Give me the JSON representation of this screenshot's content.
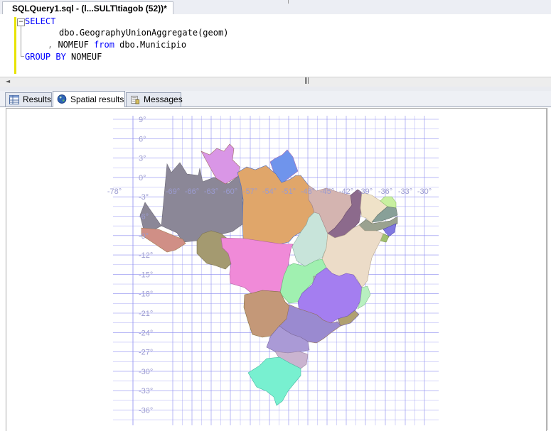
{
  "window": {
    "tab_title": "SQLQuery1.sql - (l...SULT\\tiagob (52))*"
  },
  "editor": {
    "line1": {
      "keyword": "SELECT"
    },
    "line2": {
      "text": "dbo.GeographyUnionAggregate(geom)"
    },
    "line3": {
      "comma": ",",
      "col": " NOMEUF ",
      "from_kw": "from",
      "table": " dbo.Municipio"
    },
    "line4": {
      "group_kw": "GROUP BY",
      "col": " NOMEUF"
    },
    "fold_symbol": "−"
  },
  "result_tabs": [
    {
      "label": "Results",
      "icon": "grid-icon"
    },
    {
      "label": "Spatial results",
      "icon": "globe-icon",
      "active": true
    },
    {
      "label": "Messages",
      "icon": "messages-icon"
    }
  ],
  "spatial": {
    "lon_labels": [
      "-78°",
      "-69°",
      "-66°",
      "-63°",
      "-60°",
      "-57°",
      "-54°",
      "-51°",
      "-48°",
      "-45°",
      "-42°",
      "-39°",
      "-36°",
      "-33°",
      "-30°"
    ],
    "lat_labels": [
      "9°",
      "6°",
      "3°",
      "0°",
      "-3°",
      "-6°",
      "-9°",
      "-12°",
      "-15°",
      "-18°",
      "-21°",
      "-24°",
      "-27°",
      "-30°",
      "-33°",
      "-36°"
    ],
    "grid_color": "#8c8cf0",
    "label_color": "#9b9bd0",
    "states": [
      {
        "name": "Amazonas",
        "color": "#8b8797"
      },
      {
        "name": "Roraima",
        "color": "#d08f86"
      },
      {
        "name": "Amapá",
        "color": "#d996e6"
      },
      {
        "name": "Pará",
        "color": "#6f94ec"
      },
      {
        "name": "Acre",
        "color": "#e0a66a"
      },
      {
        "name": "Rondônia",
        "color": "#a49a70"
      },
      {
        "name": "Mato Grosso",
        "color": "#f08ad8"
      },
      {
        "name": "Tocantins",
        "color": "#c8e4da"
      },
      {
        "name": "Maranhão",
        "color": "#d4b4b0"
      },
      {
        "name": "Piauí",
        "color": "#8c6a8c"
      },
      {
        "name": "Ceará",
        "color": "#efe2c8"
      },
      {
        "name": "Rio Grande do Norte",
        "color": "#c8f0a0"
      },
      {
        "name": "Paraíba",
        "color": "#88a098"
      },
      {
        "name": "Pernambuco",
        "color": "#9aa290"
      },
      {
        "name": "Alagoas",
        "color": "#8078e0"
      },
      {
        "name": "Sergipe",
        "color": "#a0c070"
      },
      {
        "name": "Bahia",
        "color": "#ecdcc8"
      },
      {
        "name": "Goiás",
        "color": "#a0f0b0"
      },
      {
        "name": "Distrito Federal",
        "color": "#b0b0b0"
      },
      {
        "name": "Minas Gerais",
        "color": "#a47ef0"
      },
      {
        "name": "Espírito Santo",
        "color": "#b8f0c0"
      },
      {
        "name": "Mato Grosso do Sul",
        "color": "#b0a070"
      },
      {
        "name": "São Paulo",
        "color": "#c49878"
      },
      {
        "name": "Rio de Janeiro",
        "color": "#9a8ad0"
      },
      {
        "name": "Paraná",
        "color": "#aa9ad6"
      },
      {
        "name": "Santa Catarina",
        "color": "#cab4d0"
      },
      {
        "name": "Rio Grande do Sul",
        "color": "#78f0d0"
      }
    ]
  }
}
